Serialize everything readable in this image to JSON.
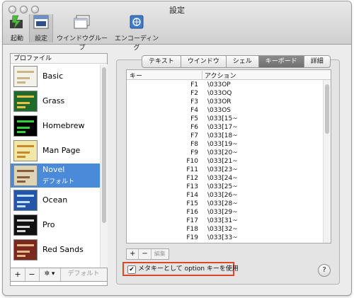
{
  "window": {
    "title": "設定"
  },
  "toolbar": {
    "items": [
      {
        "label": "起動",
        "icon": "launch-icon"
      },
      {
        "label": "設定",
        "icon": "settings-icon"
      },
      {
        "label": "ウインドウグループ",
        "icon": "window-group-icon"
      },
      {
        "label": "エンコーディング",
        "icon": "encoding-icon"
      }
    ]
  },
  "sidebar": {
    "header": "プロファイル",
    "profiles": [
      {
        "name": "Basic",
        "thumb_bg": "#f4f2e8",
        "thumb_fg": "#c8b48a"
      },
      {
        "name": "Grass",
        "thumb_bg": "#1f6b2c",
        "thumb_fg": "#e6c24a"
      },
      {
        "name": "Homebrew",
        "thumb_bg": "#000000",
        "thumb_fg": "#2ed43a"
      },
      {
        "name": "Man Page",
        "thumb_bg": "#f3e7a6",
        "thumb_fg": "#c58a2f"
      },
      {
        "name": "Novel",
        "sub": "デフォルト",
        "thumb_bg": "#ded4b6",
        "thumb_fg": "#8a5a3a",
        "selected": true
      },
      {
        "name": "Ocean",
        "thumb_bg": "#2356a8",
        "thumb_fg": "#bfe0ff"
      },
      {
        "name": "Pro",
        "thumb_bg": "#111111",
        "thumb_fg": "#d8d8d8"
      },
      {
        "name": "Red Sands",
        "thumb_bg": "#7a2a1e",
        "thumb_fg": "#e7b98a"
      }
    ],
    "bottom": {
      "add": "+",
      "remove": "−",
      "gear": "✲ ▾",
      "default": "デフォルト"
    }
  },
  "tabs": [
    {
      "label": "テキスト"
    },
    {
      "label": "ウインドウ"
    },
    {
      "label": "シェル"
    },
    {
      "label": "キーボード",
      "selected": true
    },
    {
      "label": "詳細"
    }
  ],
  "keyboard": {
    "col_key": "キー",
    "col_action": "アクション",
    "rows": [
      {
        "key": "F1",
        "action": "\\033OP"
      },
      {
        "key": "F2",
        "action": "\\033OQ"
      },
      {
        "key": "F3",
        "action": "\\033OR"
      },
      {
        "key": "F4",
        "action": "\\033OS"
      },
      {
        "key": "F5",
        "action": "\\033[15~"
      },
      {
        "key": "F6",
        "action": "\\033[17~"
      },
      {
        "key": "F7",
        "action": "\\033[18~"
      },
      {
        "key": "F8",
        "action": "\\033[19~"
      },
      {
        "key": "F9",
        "action": "\\033[20~"
      },
      {
        "key": "F10",
        "action": "\\033[21~"
      },
      {
        "key": "F11",
        "action": "\\033[23~"
      },
      {
        "key": "F12",
        "action": "\\033[24~"
      },
      {
        "key": "F13",
        "action": "\\033[25~"
      },
      {
        "key": "F14",
        "action": "\\033[26~"
      },
      {
        "key": "F15",
        "action": "\\033[28~"
      },
      {
        "key": "F16",
        "action": "\\033[29~"
      },
      {
        "key": "F17",
        "action": "\\033[31~"
      },
      {
        "key": "F18",
        "action": "\\033[32~"
      },
      {
        "key": "F19",
        "action": "\\033[33~"
      }
    ],
    "add": "+",
    "remove": "−",
    "edit": "編集",
    "meta_label": "メタキーとして option キーを使用",
    "meta_checked": true,
    "help": "?"
  },
  "colors": {
    "accent": "#4a8ad8",
    "highlight_box": "#e0442a"
  }
}
